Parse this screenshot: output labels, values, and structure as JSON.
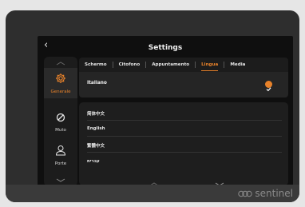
{
  "header": {
    "title": "Settings",
    "back_icon": "back-chevron-icon"
  },
  "sidebar": {
    "items": [
      {
        "label": "Generale",
        "icon": "gear-icon",
        "active": true
      },
      {
        "label": "Muto",
        "icon": "mute-icon",
        "active": false
      },
      {
        "label": "Porte",
        "icon": "user-icon",
        "active": false
      }
    ]
  },
  "tabs": [
    {
      "label": "Schermo",
      "active": false
    },
    {
      "label": "Citofono",
      "active": false
    },
    {
      "label": "Appuntamento",
      "active": false
    },
    {
      "label": "Lingua",
      "active": true
    },
    {
      "label": "Media",
      "active": false
    }
  ],
  "current_language": {
    "label": "Italiano",
    "selected": true
  },
  "languages": [
    "简体中文",
    "English",
    "繁體中文",
    "עברית"
  ],
  "brand": "sentinel",
  "colors": {
    "accent": "#e8822a",
    "panel": "#1e1e1e",
    "background": "#0f0f0f"
  }
}
